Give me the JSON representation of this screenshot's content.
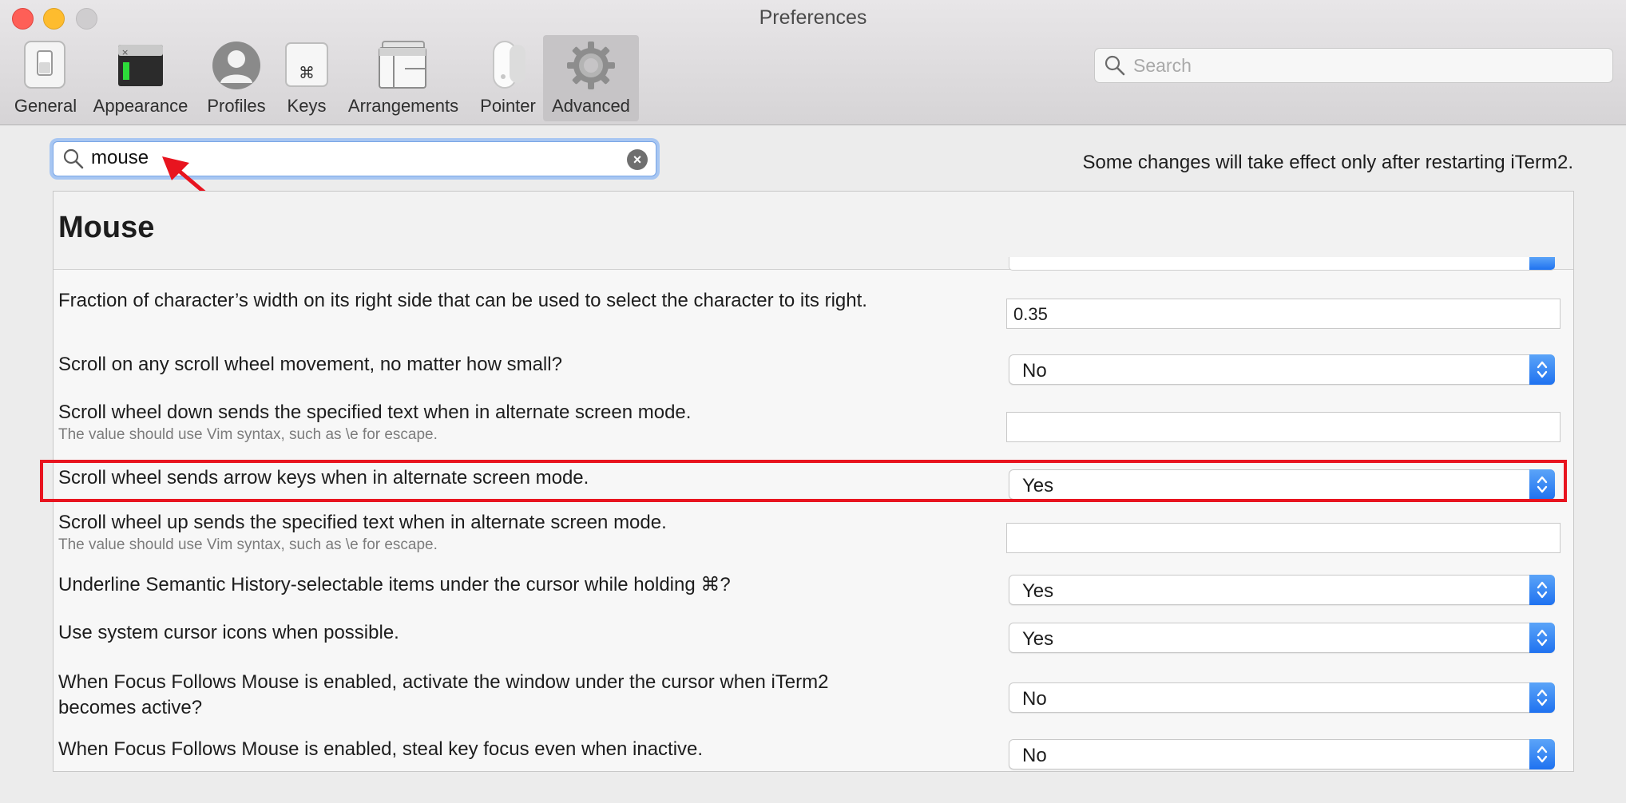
{
  "window": {
    "title": "Preferences"
  },
  "toolbar": {
    "items": [
      {
        "label": "General",
        "icon": "general-switch-icon"
      },
      {
        "label": "Appearance",
        "icon": "appearance-terminal-icon"
      },
      {
        "label": "Profiles",
        "icon": "profiles-person-icon"
      },
      {
        "label": "Keys",
        "icon": "keys-command-icon"
      },
      {
        "label": "Arrangements",
        "icon": "arrangements-windows-icon"
      },
      {
        "label": "Pointer",
        "icon": "pointer-mouse-icon"
      },
      {
        "label": "Advanced",
        "icon": "advanced-gear-icon"
      }
    ],
    "selected": "Advanced",
    "search_placeholder": "Search"
  },
  "filter": {
    "value": "mouse",
    "clear_icon": "clear-circle-icon"
  },
  "notice": "Some changes will take effect only after restarting iTerm2.",
  "section": {
    "title": "Mouse"
  },
  "settings": [
    {
      "question": "Fraction of character’s width on its right side that can be used to select the character to its right.",
      "control": "text",
      "value": "0.35"
    },
    {
      "question": "Scroll on any scroll wheel movement, no matter how small?",
      "control": "popup",
      "value": "No"
    },
    {
      "question": "Scroll wheel down sends the specified text when in alternate screen mode.",
      "subtitle": "The value should use Vim syntax, such as \\e for escape.",
      "control": "text",
      "value": ""
    },
    {
      "question": "Scroll wheel sends arrow keys when in alternate screen mode.",
      "control": "popup",
      "value": "Yes",
      "highlighted": true
    },
    {
      "question": "Scroll wheel up sends the specified text when in alternate screen mode.",
      "subtitle": "The value should use Vim syntax, such as \\e for escape.",
      "control": "text",
      "value": ""
    },
    {
      "question": "Underline Semantic History-selectable items under the cursor while holding ⌘?",
      "control": "popup",
      "value": "Yes"
    },
    {
      "question": "Use system cursor icons when possible.",
      "control": "popup",
      "value": "Yes"
    },
    {
      "question_line1": "When Focus Follows Mouse is enabled, activate the window under the cursor when iTerm2",
      "question_line2": "becomes active?",
      "control": "popup",
      "value": "No"
    },
    {
      "question": "When Focus Follows Mouse is enabled, steal key focus even when inactive.",
      "control": "popup",
      "value": "No"
    }
  ],
  "colors": {
    "highlight_box": "#e8141f",
    "annotation_arrow": "#e8141f",
    "popup_accent": "#1f72f0"
  }
}
